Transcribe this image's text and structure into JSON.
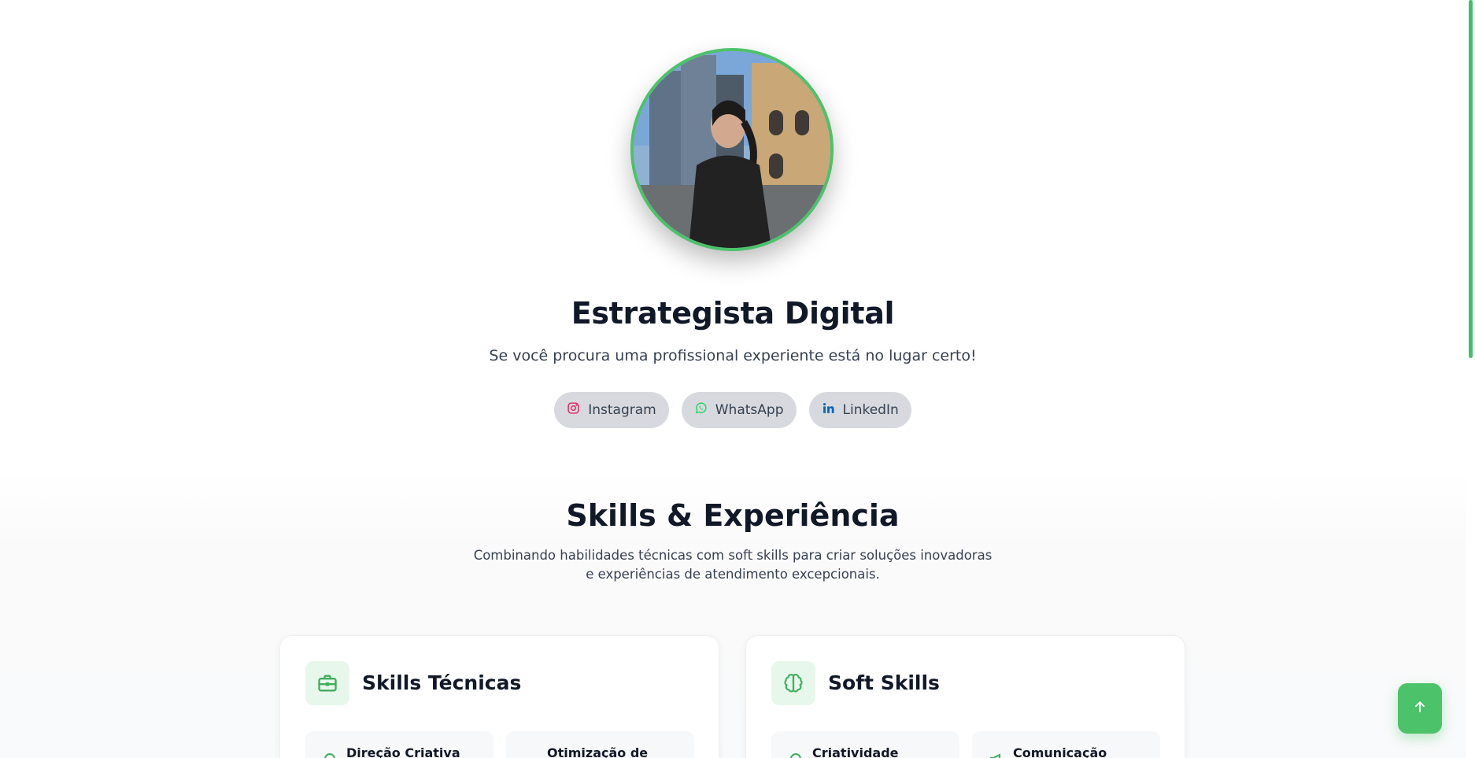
{
  "hero": {
    "title": "Estrategista Digital",
    "subtitle": "Se você procura uma profissional experiente está no lugar certo!"
  },
  "socials": [
    {
      "label": "Instagram",
      "icon": "instagram-icon",
      "color": "#e1306c"
    },
    {
      "label": "WhatsApp",
      "icon": "whatsapp-icon",
      "color": "#25d366"
    },
    {
      "label": "LinkedIn",
      "icon": "linkedin-icon",
      "color": "#0a66c2"
    }
  ],
  "skills_section": {
    "title": "Skills & Experiência",
    "subtitle": "Combinando habilidades técnicas com soft skills para criar soluções inovadoras e experiências de atendimento excepcionais."
  },
  "cards": {
    "tech": {
      "title": "Skills Técnicas",
      "icon": "briefcase-icon",
      "items": [
        "Direção Criativa",
        "Otimização de"
      ]
    },
    "soft": {
      "title": "Soft Skills",
      "icon": "brain-icon",
      "items": [
        "Criatividade",
        "Comunicação"
      ]
    }
  },
  "colors": {
    "accent": "#4cc26a",
    "accent_light": "#e8f7ec",
    "pill_bg": "#d7d9de"
  },
  "scroll_to_top": {
    "icon": "arrow-up-icon"
  }
}
